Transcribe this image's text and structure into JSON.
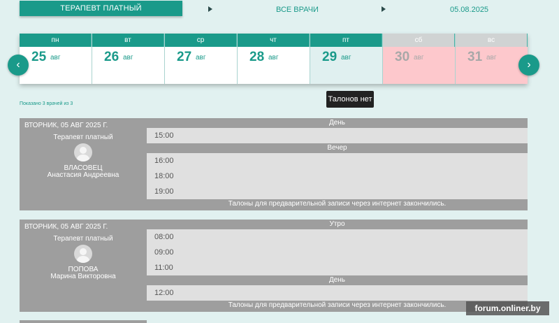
{
  "top": {
    "service": "ТЕРАПЕВТ ПЛАТНЫЙ",
    "doctors": "ВСЕ ВРАЧИ",
    "date": "05.08.2025"
  },
  "calendar": {
    "days": [
      {
        "wd": "пн",
        "num": "25",
        "mon": "авг",
        "state": "normal"
      },
      {
        "wd": "вт",
        "num": "26",
        "mon": "авг",
        "state": "normal"
      },
      {
        "wd": "ср",
        "num": "27",
        "mon": "авг",
        "state": "normal"
      },
      {
        "wd": "чт",
        "num": "28",
        "mon": "авг",
        "state": "normal"
      },
      {
        "wd": "пт",
        "num": "29",
        "mon": "авг",
        "state": "selected"
      },
      {
        "wd": "сб",
        "num": "30",
        "mon": "авг",
        "state": "off"
      },
      {
        "wd": "вс",
        "num": "31",
        "mon": "авг",
        "state": "off"
      }
    ],
    "prev": "‹",
    "next": "›",
    "tooltip": "Талонов нет"
  },
  "shown": "Показано 3 врачей из 3",
  "cards": [
    {
      "date": "ВТОРНИК, 05 АВГ 2025 Г.",
      "spec": "Терапевт платный",
      "surname": "ВЛАСОВЕЦ",
      "first": "Анастасия Андреевна",
      "sections": [
        {
          "title": "День",
          "slots": [
            "15:00"
          ]
        },
        {
          "title": "Вечер",
          "slots": [
            "16:00",
            "18:00",
            "19:00"
          ]
        }
      ],
      "note": "Талоны для предварительной записи через интернет закончились."
    },
    {
      "date": "ВТОРНИК, 05 АВГ 2025 Г.",
      "spec": "Терапевт платный",
      "surname": "ПОПОВА",
      "first": "Марина Викторовна",
      "sections": [
        {
          "title": "Утро",
          "slots": [
            "08:00",
            "09:00",
            "11:00"
          ]
        },
        {
          "title": "День",
          "slots": [
            "12:00"
          ]
        }
      ],
      "note": "Талоны для предварительной записи через интернет закончились."
    }
  ],
  "watermark": "forum.onliner.by",
  "colors": {
    "accent": "#1a9a8a",
    "off": "#fdc8cc",
    "card": "#9e9e9e"
  }
}
